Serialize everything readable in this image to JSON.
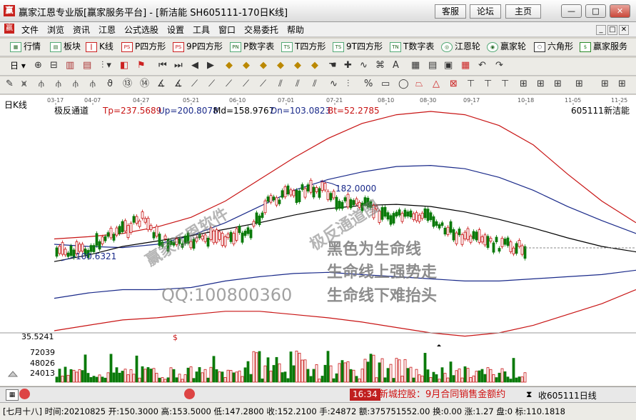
{
  "window": {
    "title": "赢家江恩专业版[赢家服务平台] - [新洁能  SH605111-170日K线]",
    "app_icon": "赢",
    "top_buttons": [
      "客服",
      "论坛",
      "主页"
    ],
    "controls": {
      "minimize": "—",
      "maximize": "□",
      "close": "✕"
    }
  },
  "menu": {
    "items": [
      "文件",
      "浏览",
      "资讯",
      "江恩",
      "公式选股",
      "设置",
      "工具",
      "窗口",
      "交易委托",
      "帮助"
    ],
    "mdi_controls": [
      "_",
      "□",
      "✕"
    ]
  },
  "toolbar1": {
    "items": [
      {
        "icon": "grid-icon",
        "label": "行情"
      },
      {
        "icon": "blocks-icon",
        "label": "板块"
      },
      {
        "icon": "kline-icon",
        "label": "K线"
      },
      {
        "icon": "ps-icon",
        "badge": "PS",
        "label": "P四方形"
      },
      {
        "icon": "ps9-icon",
        "badge": "PS",
        "label": "9P四方形"
      },
      {
        "icon": "pn-icon",
        "badge": "PN",
        "label": "P数字表"
      },
      {
        "icon": "ts-icon",
        "badge": "TS",
        "label": "T四方形"
      },
      {
        "icon": "ts9-icon",
        "badge": "TS",
        "label": "9T四方形"
      },
      {
        "icon": "tn-icon",
        "badge": "TN",
        "label": "T数字表"
      },
      {
        "icon": "gann-wheel-icon",
        "label": "江恩轮"
      },
      {
        "icon": "winner-wheel-icon",
        "label": "赢家轮"
      },
      {
        "icon": "hexagon-icon",
        "label": "六角形"
      },
      {
        "icon": "dollar-icon",
        "label": "赢家服务"
      }
    ]
  },
  "toolbar2": {
    "period_label": "日"
  },
  "chart": {
    "period_title": "日K线",
    "indicator": {
      "name": "极反通道",
      "tp": "Tp=237.5689",
      "up": "Up=200.8078",
      "md": "Md=158.9767",
      "dn": "Dn=103.0823",
      "bt": "Bt=52.2785"
    },
    "stock_code": "605111",
    "stock_name": "新洁能",
    "date_ticks": [
      "03-17",
      "04-07",
      "04-27",
      "05-21",
      "06-10",
      "07-01",
      "07-21",
      "08-10",
      "08-30",
      "09-17",
      "10-18",
      "11-05",
      "11-25"
    ],
    "high_marker": "182.0000",
    "low_marker": "100.6321",
    "volume_axis": [
      "35.5241",
      "72039",
      "48026",
      "24013"
    ],
    "watermarks": {
      "w1": "赢家江恩软件",
      "w2": "极反通道图",
      "qq": "QQ:100800360",
      "note1": "黑色为生命线",
      "note2": "生命线上强势走",
      "note3": "生命线下难抬头"
    },
    "dollar_marker": "$"
  },
  "chart_data": {
    "type": "line",
    "title": "极反通道",
    "x": [
      0,
      10,
      20,
      30,
      40,
      50,
      60,
      70,
      80,
      90,
      100,
      110,
      120,
      130,
      140,
      150,
      160,
      170
    ],
    "series": [
      {
        "name": "Tp",
        "color": "#c81414",
        "values": [
          125,
          127,
          130,
          136,
          145,
          160,
          180,
          200,
          218,
          232,
          240,
          243,
          240,
          230,
          212,
          185,
          160,
          140
        ]
      },
      {
        "name": "Up",
        "color": "#1a2a8a",
        "values": [
          120,
          118,
          117,
          120,
          128,
          140,
          155,
          170,
          180,
          187,
          192,
          193,
          190,
          182,
          170,
          155,
          142,
          130
        ]
      },
      {
        "name": "Md",
        "color": "#000000",
        "values": [
          104,
          110,
          118,
          123,
          128,
          134,
          140,
          147,
          153,
          156,
          157,
          155,
          150,
          143,
          135,
          126,
          118,
          113
        ]
      },
      {
        "name": "Dn",
        "color": "#1a2a8a",
        "values": [
          70,
          75,
          78,
          78,
          80,
          86,
          90,
          93,
          94,
          92,
          90,
          88,
          86,
          86,
          88,
          90,
          92,
          96
        ]
      },
      {
        "name": "Bt",
        "color": "#c81414",
        "values": [
          40,
          45,
          50,
          52,
          55,
          58,
          58,
          55,
          52,
          48,
          43,
          38,
          35,
          38,
          45,
          55,
          65,
          78
        ]
      }
    ],
    "annotations": {
      "high": 182.0,
      "low": 100.6321
    },
    "ylim": [
      40,
      245
    ]
  },
  "status": {
    "ticker_time": "16:34",
    "ticker_text": "新城控股：9月合同销售金额约",
    "ticker_right": "收605111日线",
    "info": "[七月十八] 时间:20210825 开:150.3000 高:153.5000 低:147.2800 收:152.2100 手:24872 额:375751552.00 换:0.00 涨:1.27 盘:0 标:110.1818"
  }
}
